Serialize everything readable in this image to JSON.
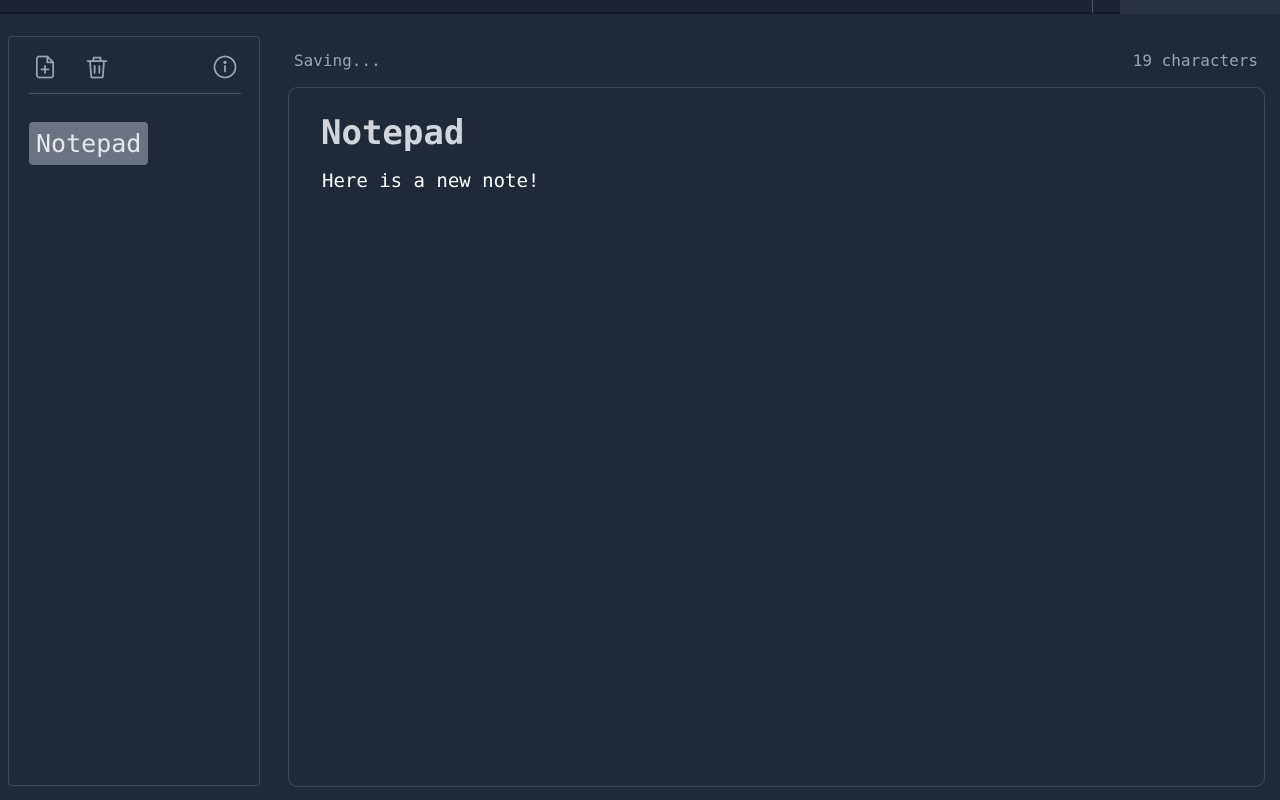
{
  "toolbar": {
    "new_note_icon": "file-plus-icon",
    "delete_icon": "trash-icon",
    "info_icon": "info-icon"
  },
  "sidebar": {
    "notes": [
      {
        "title": "Notepad",
        "selected": true
      }
    ]
  },
  "status": {
    "saving": "Saving...",
    "char_count": "19 characters"
  },
  "editor": {
    "title": "Notepad",
    "body": "Here is a new note!"
  },
  "colors": {
    "background": "#1f2937",
    "border": "#3a4657",
    "selected_item": "#6b7280",
    "muted_text": "#9ca3af"
  }
}
